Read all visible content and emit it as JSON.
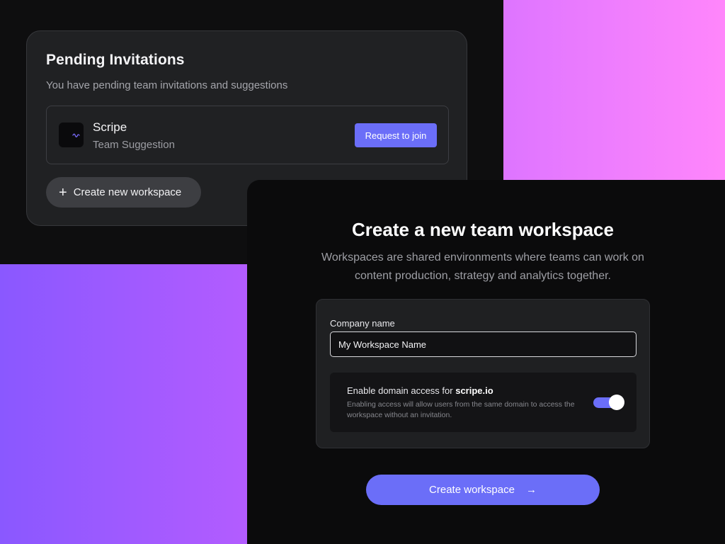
{
  "invitations": {
    "title": "Pending Invitations",
    "subtitle": "You have pending team invitations and suggestions",
    "team": {
      "name": "Scripe",
      "type": "Team Suggestion",
      "logo_icon": "soundwave-logo-icon",
      "action_label": "Request to join"
    },
    "create_label": "Create new workspace"
  },
  "workspace_form": {
    "title": "Create a new team workspace",
    "description": "Workspaces are shared environments where teams can work on content production, strategy and analytics together.",
    "company_label": "Company name",
    "company_value": "My Workspace Name",
    "domain_access": {
      "label": "Enable domain access for",
      "domain": "scripe.io",
      "note": "Enabling access will allow users from the same domain to access the workspace without an invitation.",
      "enabled": true
    },
    "submit_label": "Create workspace"
  },
  "colors": {
    "accent": "#6b6ef8",
    "panel": "#0b0b0c",
    "card": "#202123"
  }
}
